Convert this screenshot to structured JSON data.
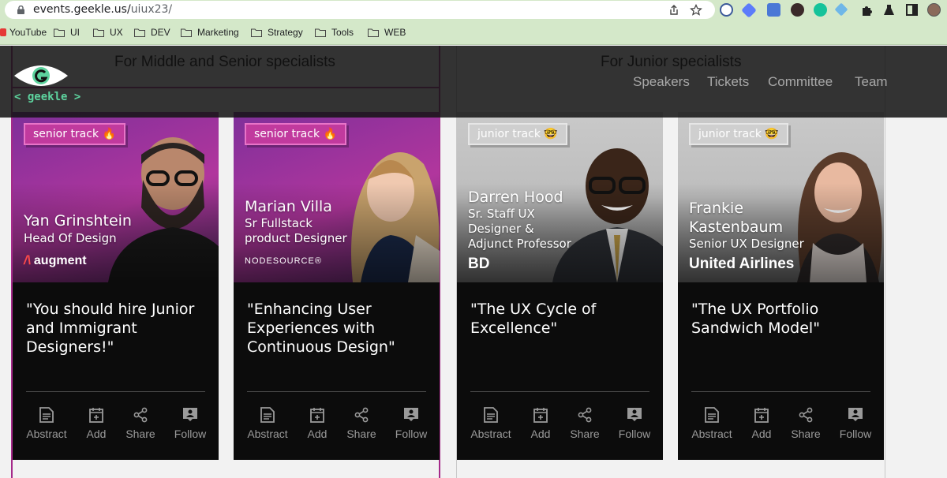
{
  "browser": {
    "url_host": "events.geekle.us/",
    "url_path": "uiux23/",
    "bookmarks": [
      {
        "label": "YouTube",
        "icon": "youtube-icon"
      },
      {
        "label": "UI",
        "icon": "folder-icon"
      },
      {
        "label": "UX",
        "icon": "folder-icon"
      },
      {
        "label": "DEV",
        "icon": "folder-icon"
      },
      {
        "label": "Marketing",
        "icon": "folder-icon"
      },
      {
        "label": "Strategy",
        "icon": "folder-icon"
      },
      {
        "label": "Tools",
        "icon": "folder-icon"
      },
      {
        "label": "WEB",
        "icon": "folder-icon"
      }
    ]
  },
  "header": {
    "logo_text": "< geekle >",
    "nav": [
      "Speakers",
      "Tickets",
      "Committee",
      "Team"
    ]
  },
  "columns": {
    "senior": "For Middle and Senior specialists",
    "junior": "For Junior specialists"
  },
  "cards": [
    {
      "track": "senior track 🔥",
      "name": "Yan Grinshtein",
      "role": "Head Of Design",
      "company": "augment",
      "talk": "\"You should hire Junior and Immigrant Designers!\""
    },
    {
      "track": "senior track 🔥",
      "name": "Marian Villa",
      "role": "Sr Fullstack product Designer",
      "company": "NODESOURCE®",
      "talk": "\"Enhancing User Experiences with Continuous Design\""
    },
    {
      "track": "junior track 🤓",
      "name": "Darren Hood",
      "role": "Sr. Staff UX Designer & Adjunct Professor",
      "company": "BD",
      "talk": "\"The UX Cycle of Excellence\""
    },
    {
      "track": "junior track 🤓",
      "name": "Frankie Kastenbaum",
      "role": "Senior UX Designer",
      "company": "United Airlines",
      "talk": "\"The UX Portfolio Sandwich Model\""
    }
  ],
  "actions": [
    "Abstract",
    "Add",
    "Share",
    "Follow"
  ],
  "colors": {
    "senior_accent": "#c13a9e",
    "logo_green": "#5dd39e",
    "card_bg": "#0c0c0c"
  }
}
